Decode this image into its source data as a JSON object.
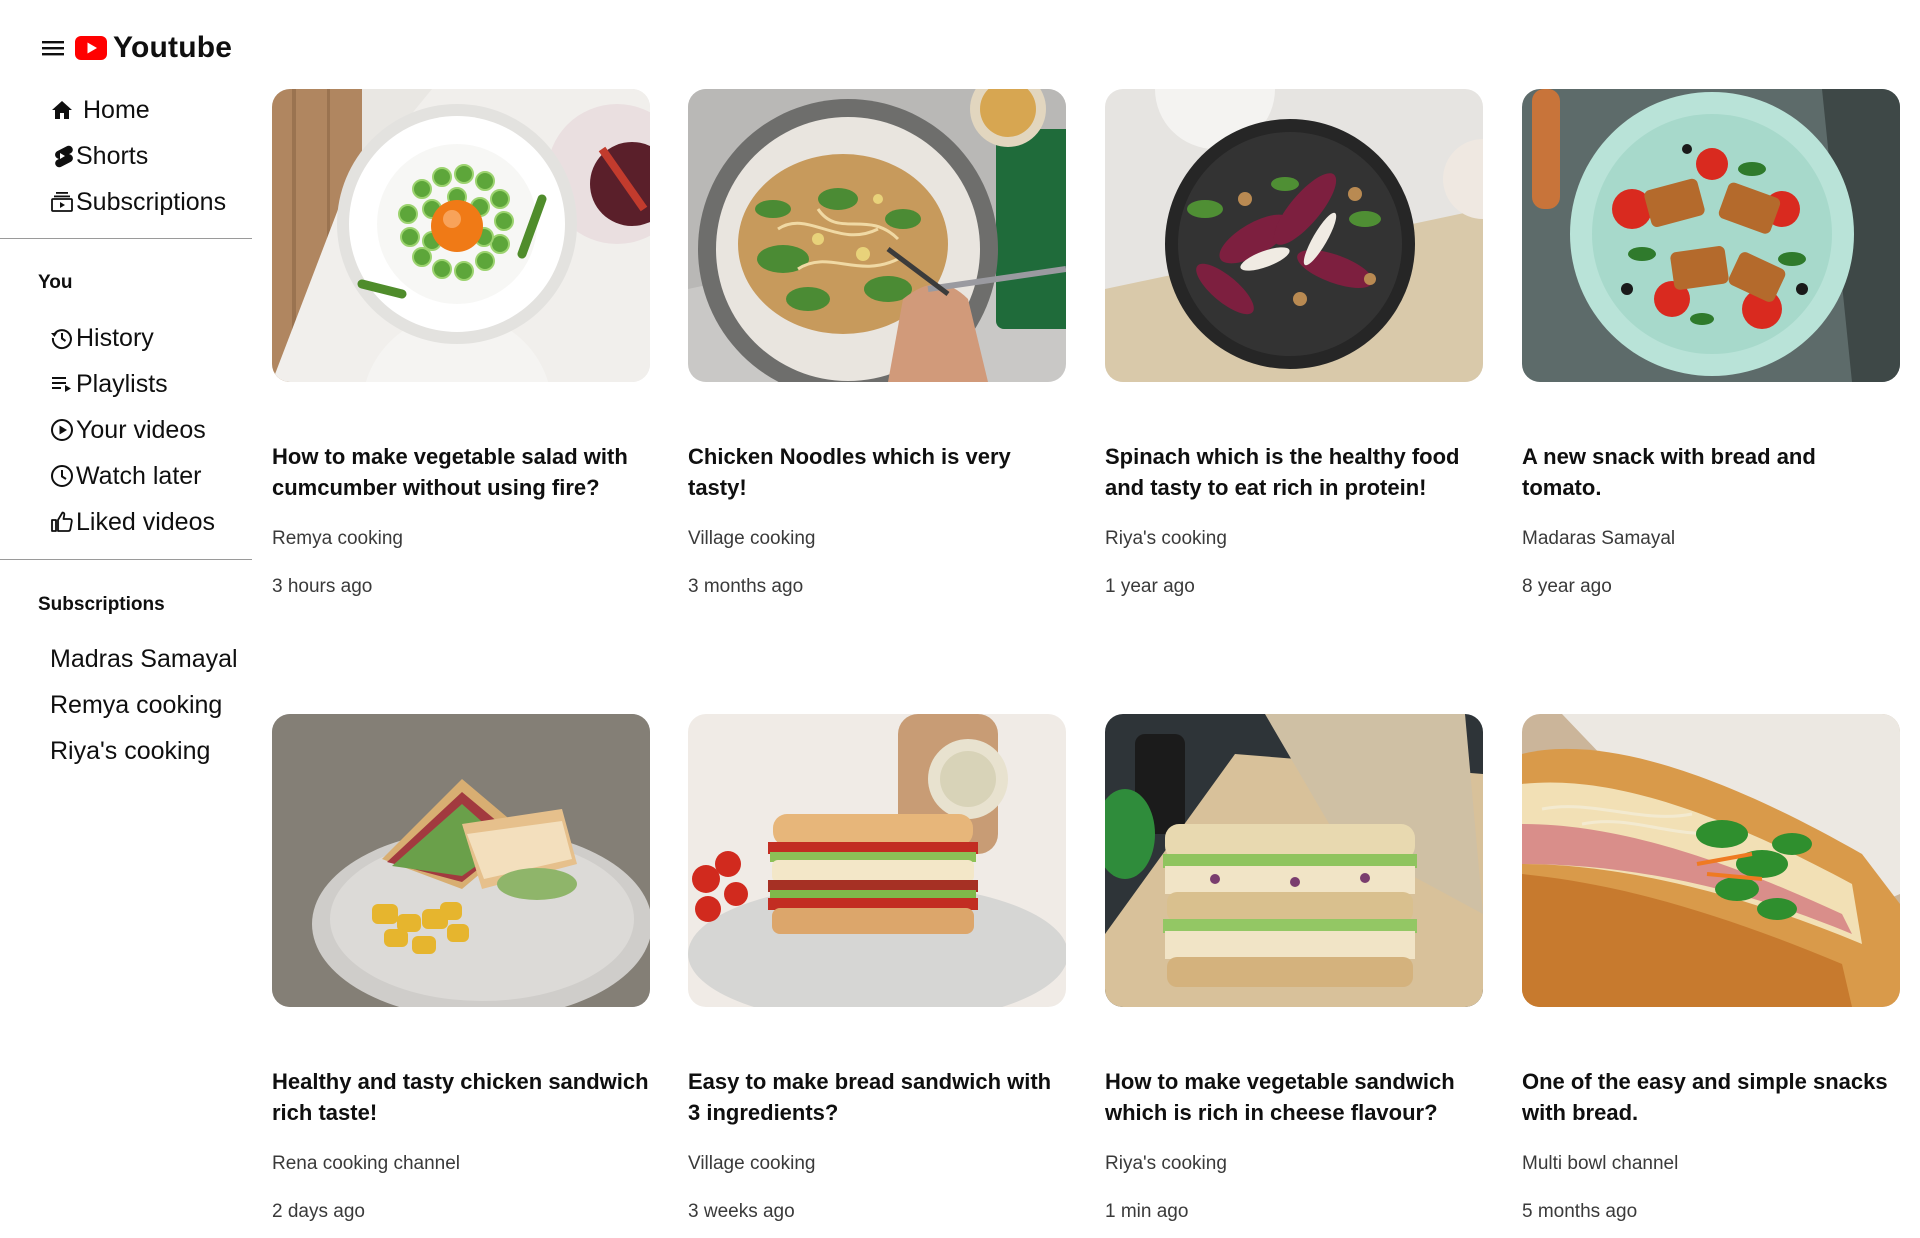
{
  "brand": {
    "title": "Youtube"
  },
  "nav": {
    "home": "Home",
    "shorts": "Shorts",
    "subscriptions": "Subscriptions"
  },
  "you": {
    "title": "You",
    "history": "History",
    "playlists": "Playlists",
    "your_videos": "Your videos",
    "watch_later": "Watch later",
    "liked_videos": "Liked videos"
  },
  "subscriptions": {
    "title": "Subscriptions",
    "channels": [
      "Madras Samayal",
      "Remya cooking",
      "Riya's cooking"
    ]
  },
  "videos": [
    {
      "title": "How to make vegetable salad with cumcumber without using fire?",
      "channel": "Remya cooking",
      "age": "3 hours ago"
    },
    {
      "title": "Chicken Noodles which is very tasty!",
      "channel": "Village cooking",
      "age": "3 months ago"
    },
    {
      "title": "Spinach which is the healthy food and tasty to eat rich in protein!",
      "channel": "Riya's cooking",
      "age": "1 year ago"
    },
    {
      "title": "A new snack with bread and tomato.",
      "channel": "Madaras Samayal",
      "age": "8 year ago"
    },
    {
      "title": "Healthy and tasty chicken sandwich rich taste!",
      "channel": "Rena cooking channel",
      "age": "2 days ago"
    },
    {
      "title": "Easy to make bread sandwich with 3 ingredients?",
      "channel": "Village cooking",
      "age": "3 weeks ago"
    },
    {
      "title": "How to make vegetable sandwich which is rich in cheese flavour?",
      "channel": "Riya's cooking",
      "age": "1 min ago"
    },
    {
      "title": "One of the easy and simple snacks with bread.",
      "channel": "Multi bowl channel",
      "age": "5 months ago"
    }
  ],
  "colors": {
    "brand_red": "#ff0000",
    "text": "#0f0f0f",
    "meta": "#3a3a3a"
  }
}
